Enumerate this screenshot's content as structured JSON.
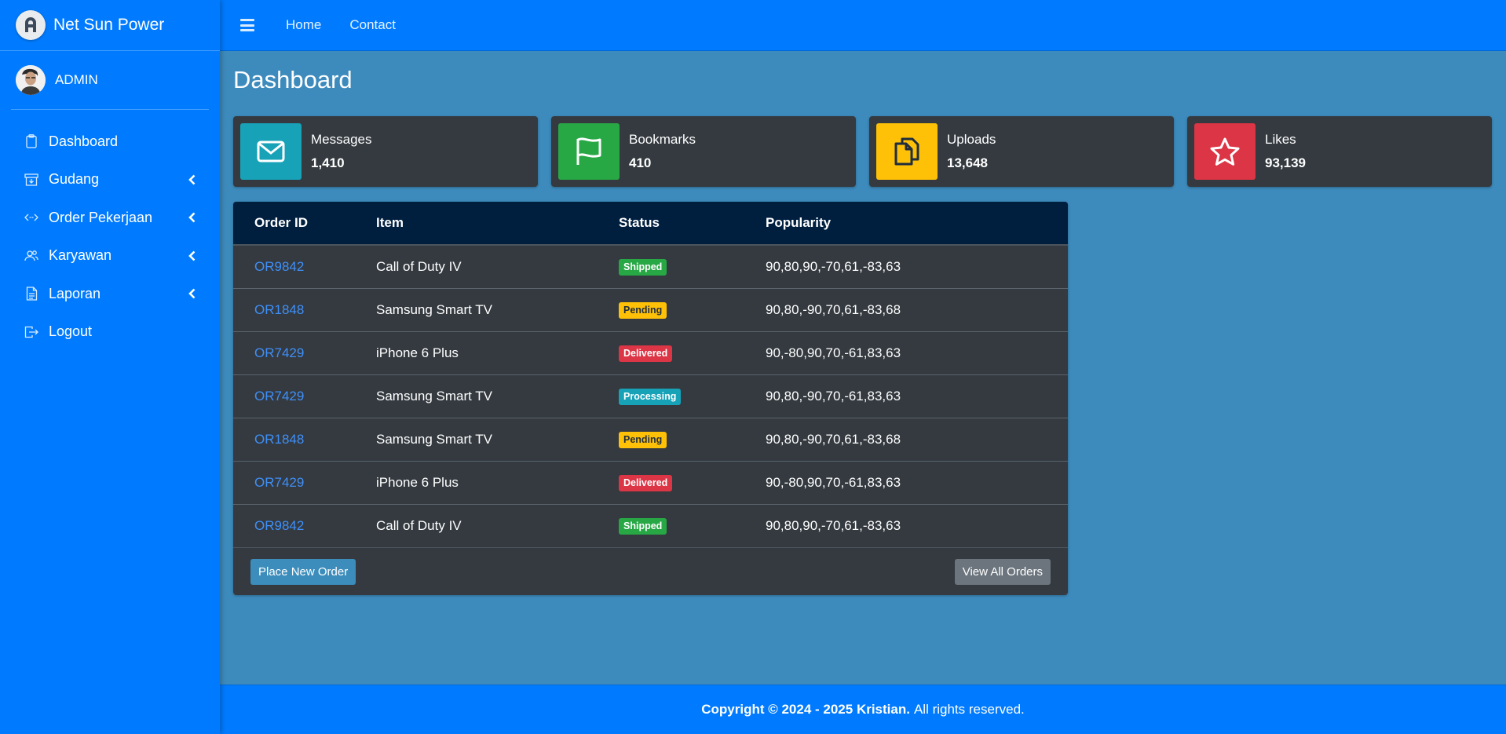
{
  "brand": {
    "name": "Net Sun Power",
    "logo_icon": "brand-logo-icon"
  },
  "user": {
    "name": "ADMIN"
  },
  "sidebar": {
    "items": [
      {
        "label": "Dashboard",
        "icon": "clipboard-icon",
        "has_submenu": false
      },
      {
        "label": "Gudang",
        "icon": "archive-icon",
        "has_submenu": true
      },
      {
        "label": "Order Pekerjaan",
        "icon": "code-arrows-icon",
        "has_submenu": true
      },
      {
        "label": "Karyawan",
        "icon": "users-icon",
        "has_submenu": true
      },
      {
        "label": "Laporan",
        "icon": "document-icon",
        "has_submenu": true
      },
      {
        "label": "Logout",
        "icon": "logout-icon",
        "has_submenu": false
      }
    ]
  },
  "header": {
    "links": [
      "Home",
      "Contact"
    ]
  },
  "page": {
    "title": "Dashboard"
  },
  "info_boxes": [
    {
      "label": "Messages",
      "value": "1,410",
      "color": "#17a2b8",
      "icon": "envelope-icon"
    },
    {
      "label": "Bookmarks",
      "value": "410",
      "color": "#28a745",
      "icon": "flag-icon"
    },
    {
      "label": "Uploads",
      "value": "13,648",
      "color": "#ffc107",
      "icon": "copy-icon"
    },
    {
      "label": "Likes",
      "value": "93,139",
      "color": "#dc3545",
      "icon": "star-icon"
    }
  ],
  "orders": {
    "columns": [
      "Order ID",
      "Item",
      "Status",
      "Popularity"
    ],
    "rows": [
      {
        "id": "OR9842",
        "item": "Call of Duty IV",
        "status": "Shipped",
        "status_type": "success",
        "popularity": "90,80,90,-70,61,-83,63"
      },
      {
        "id": "OR1848",
        "item": "Samsung Smart TV",
        "status": "Pending",
        "status_type": "warning",
        "popularity": "90,80,-90,70,61,-83,68"
      },
      {
        "id": "OR7429",
        "item": "iPhone 6 Plus",
        "status": "Delivered",
        "status_type": "danger",
        "popularity": "90,-80,90,70,-61,83,63"
      },
      {
        "id": "OR7429",
        "item": "Samsung Smart TV",
        "status": "Processing",
        "status_type": "info",
        "popularity": "90,80,-90,70,-61,83,63"
      },
      {
        "id": "OR1848",
        "item": "Samsung Smart TV",
        "status": "Pending",
        "status_type": "warning",
        "popularity": "90,80,-90,70,61,-83,68"
      },
      {
        "id": "OR7429",
        "item": "iPhone 6 Plus",
        "status": "Delivered",
        "status_type": "danger",
        "popularity": "90,-80,90,70,-61,83,63"
      },
      {
        "id": "OR9842",
        "item": "Call of Duty IV",
        "status": "Shipped",
        "status_type": "success",
        "popularity": "90,80,90,-70,61,-83,63"
      }
    ],
    "place_order_label": "Place New Order",
    "view_all_label": "View All Orders"
  },
  "footer": {
    "copyright": "Copyright © 2024 - 2025 Kristian.",
    "rights": "All rights reserved."
  }
}
